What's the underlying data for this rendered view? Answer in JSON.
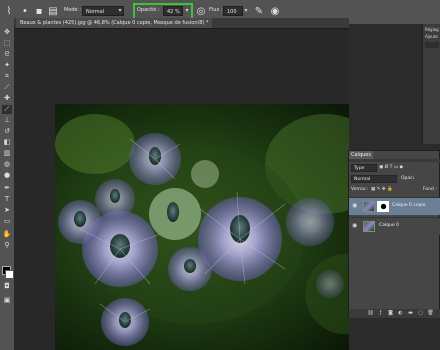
{
  "options_bar": {
    "mode_label": "Mode :",
    "mode_value": "Normal",
    "opacity_label": "Opacité :",
    "opacity_value": "42 %",
    "flow_label": "Flux :",
    "flow_value": "100 %"
  },
  "document": {
    "tab_title": "Beaux & plantes (425).jpg @ 46,8% (Calque 0 copie, Masque de fusion/8) *"
  },
  "right_panel": {
    "title": "Réglag",
    "subtitle": "Ajoute"
  },
  "layers_panel": {
    "tab_label": "Calques",
    "filter_value": "Type",
    "blend_mode": "Normal",
    "opacity_label": "Opaci",
    "lock_label": "Verrou :",
    "fill_label": "Fond :",
    "layers": [
      {
        "name": "Calque 0 copie",
        "selected": true,
        "has_mask": true
      },
      {
        "name": "Calque 0",
        "selected": false,
        "has_mask": false
      }
    ]
  },
  "colors": {
    "highlight_box": "#3fc23a",
    "panel_bg": "#464646",
    "selected_layer": "#6b7f96"
  }
}
